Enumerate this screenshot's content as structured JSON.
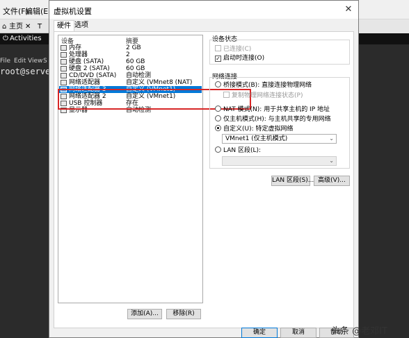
{
  "background": {
    "menubar": {
      "file": "文件(F)",
      "edit": "编辑(E)"
    },
    "tabs": {
      "home": "主页",
      "t": "T"
    },
    "gnome": {
      "activities": "Activities"
    },
    "terminal_menu": {
      "file": "File",
      "edit": "Edit",
      "view": "View",
      "s": "S"
    },
    "prompt": "root@serve"
  },
  "dialog": {
    "title": "虚拟机设置",
    "close": "✕",
    "tabs": {
      "hardware": "硬件",
      "options": "选项"
    },
    "device_list": {
      "header_device": "设备",
      "header_summary": "摘要",
      "rows": [
        {
          "name": "内存",
          "summary": "2 GB",
          "icon": "memory-icon"
        },
        {
          "name": "处理器",
          "summary": "2",
          "icon": "processor-icon"
        },
        {
          "name": "硬盘 (SATA)",
          "summary": "60 GB",
          "icon": "disk-icon"
        },
        {
          "name": "硬盘 2 (SATA)",
          "summary": "60 GB",
          "icon": "disk-icon"
        },
        {
          "name": "CD/DVD (SATA)",
          "summary": "自动检测",
          "icon": "cdrom-icon"
        },
        {
          "name": "网络适配器",
          "summary": "自定义 (VMnet8 (NAT)",
          "icon": "network-icon"
        },
        {
          "name": "网络适配器 3",
          "summary": "自定义 (VMnet1)",
          "icon": "network-icon",
          "selected": true
        },
        {
          "name": "网络适配器 2",
          "summary": "自定义 (VMnet1)",
          "icon": "network-icon"
        },
        {
          "name": "USB 控制器",
          "summary": "存在",
          "icon": "usb-icon"
        },
        {
          "name": "显示器",
          "summary": "自动检测",
          "icon": "display-icon"
        }
      ]
    },
    "buttons": {
      "add": "添加(A)...",
      "remove": "移除(R)",
      "ok": "确定",
      "cancel": "取消",
      "help": "帮助"
    },
    "device_status": {
      "label": "设备状态",
      "connected": "已连接(C)",
      "connect_at_poweron": "启动时连接(O)"
    },
    "network_connection": {
      "label": "网络连接",
      "bridged": "桥接模式(B): 直接连接物理网络",
      "replicate": "复制物理网络连接状态(P)",
      "nat": "NAT 模式(N): 用于共享主机的 IP 地址",
      "host_only": "仅主机模式(H): 与主机共享的专用网络",
      "custom": "自定义(U): 特定虚拟网络",
      "custom_value": "VMnet1 (仅主机模式)",
      "lan_segment": "LAN 区段(L):",
      "lan_segment_value": ""
    },
    "lan_segments_button": "LAN 区段(S)...",
    "advanced_button": "高级(V)..."
  },
  "watermark": "头条 @老邓IT",
  "colors": {
    "selection": "#0078d7",
    "highlight_box": "#d72626"
  }
}
